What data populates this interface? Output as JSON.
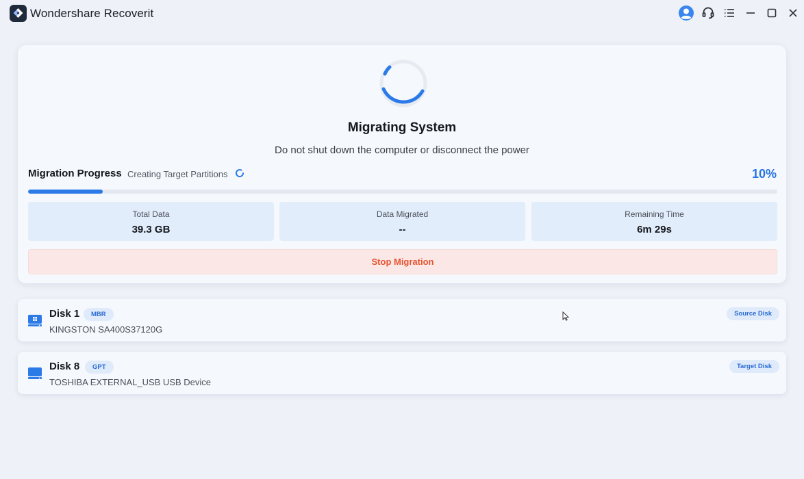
{
  "app": {
    "title": "Wondershare Recoverit"
  },
  "titlebar": {
    "icons": [
      "account-icon",
      "support-headset-icon",
      "menu-list-icon",
      "minimize-icon",
      "maximize-icon",
      "close-icon"
    ]
  },
  "migration": {
    "title": "Migrating System",
    "subtitle": "Do not shut down the computer or disconnect the power",
    "progress_label": "Migration Progress",
    "status": "Creating Target Partitions",
    "percent_text": "10%",
    "percent": 10,
    "stats": [
      {
        "label": "Total Data",
        "value": "39.3 GB"
      },
      {
        "label": "Data Migrated",
        "value": "--"
      },
      {
        "label": "Remaining Time",
        "value": "6m 29s"
      }
    ],
    "stop_label": "Stop Migration"
  },
  "disks": [
    {
      "name": "Disk 1",
      "partition_style": "MBR",
      "model": "KINGSTON SA400S37120G",
      "role": "Source Disk",
      "icon": "disk-windows-icon"
    },
    {
      "name": "Disk 8",
      "partition_style": "GPT",
      "model": "TOSHIBA EXTERNAL_USB USB Device",
      "role": "Target Disk",
      "icon": "disk-drive-icon"
    }
  ],
  "colors": {
    "accent": "#2b7ae8",
    "stop_text": "#e5532f",
    "stop_bg": "#fbe8e6",
    "background": "#eef1f7"
  }
}
